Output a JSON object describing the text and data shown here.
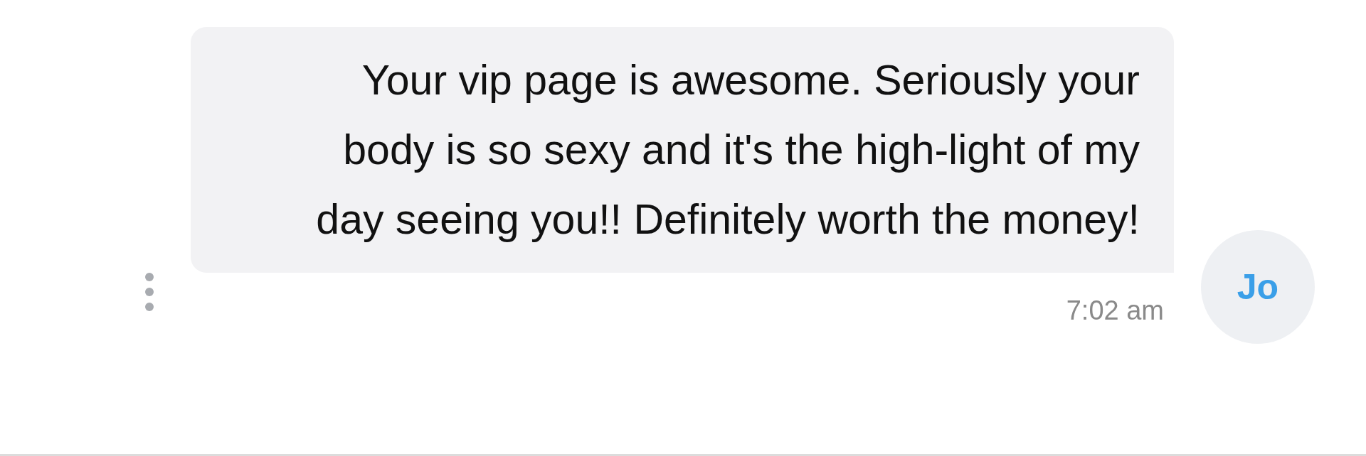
{
  "message": {
    "text": "Your vip page is awesome. Seriously your body is so sexy and it's the high-light of my day seeing you!! Definitely worth the money!",
    "time": "7:02 am"
  },
  "avatar": {
    "initials": "Jo"
  }
}
